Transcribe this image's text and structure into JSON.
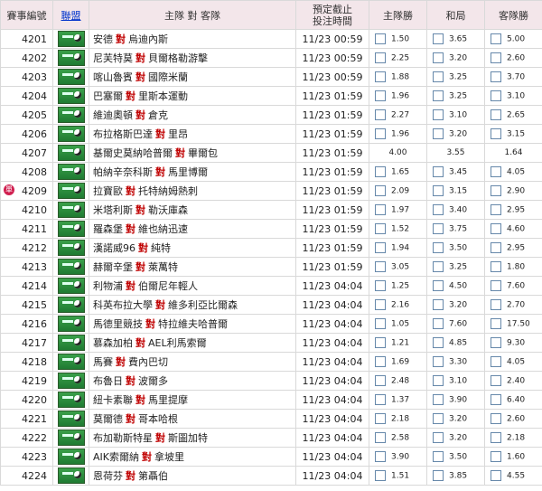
{
  "header": {
    "match_no": "賽事編號",
    "league": "聯盟",
    "teams": "主隊 對 客隊",
    "time": "預定截止\n投注時間",
    "home_win": "主隊勝",
    "draw": "和局",
    "away_win": "客隊勝"
  },
  "vs_label": "對",
  "single_badge": "單",
  "rows": [
    {
      "no": "4201",
      "home": "安德",
      "away": "烏迪內斯",
      "time": "11/23 00:59",
      "h": "1.50",
      "d": "3.65",
      "a": "5.00",
      "box": true
    },
    {
      "no": "4202",
      "home": "尼芙特莫",
      "away": "貝爾格勒游擊",
      "time": "11/23 00:59",
      "h": "2.25",
      "d": "3.20",
      "a": "2.60",
      "box": true
    },
    {
      "no": "4203",
      "home": "喀山魯賓",
      "away": "國際米蘭",
      "time": "11/23 00:59",
      "h": "1.88",
      "d": "3.25",
      "a": "3.70",
      "box": true
    },
    {
      "no": "4204",
      "home": "巴塞爾",
      "away": "里斯本運動",
      "time": "11/23 01:59",
      "h": "1.96",
      "d": "3.25",
      "a": "3.10",
      "box": true
    },
    {
      "no": "4205",
      "home": "維迪奧頓",
      "away": "倉克",
      "time": "11/23 01:59",
      "h": "2.27",
      "d": "3.10",
      "a": "2.65",
      "box": true
    },
    {
      "no": "4206",
      "home": "布拉格斯巴達",
      "away": "里昂",
      "time": "11/23 01:59",
      "h": "1.96",
      "d": "3.20",
      "a": "3.15",
      "box": true
    },
    {
      "no": "4207",
      "home": "基爾史莫納哈普爾",
      "away": "畢爾包",
      "time": "11/23 01:59",
      "h": "4.00",
      "d": "3.55",
      "a": "1.64",
      "box": false
    },
    {
      "no": "4208",
      "home": "帕納辛奈科斯",
      "away": "馬里博爾",
      "time": "11/23 01:59",
      "h": "1.65",
      "d": "3.45",
      "a": "4.05",
      "box": true
    },
    {
      "no": "4209",
      "home": "拉寶歐",
      "away": "托特納姆熱刺",
      "time": "11/23 01:59",
      "h": "2.09",
      "d": "3.15",
      "a": "2.90",
      "box": true,
      "single": true
    },
    {
      "no": "4210",
      "home": "米塔利斯",
      "away": "勒沃庫森",
      "time": "11/23 01:59",
      "h": "1.97",
      "d": "3.40",
      "a": "2.95",
      "box": true
    },
    {
      "no": "4211",
      "home": "羅森堡",
      "away": "維也納迅速",
      "time": "11/23 01:59",
      "h": "1.52",
      "d": "3.75",
      "a": "4.60",
      "box": true
    },
    {
      "no": "4212",
      "home": "漢諾威96",
      "away": "純特",
      "time": "11/23 01:59",
      "h": "1.94",
      "d": "3.50",
      "a": "2.95",
      "box": true
    },
    {
      "no": "4213",
      "home": "赫爾辛堡",
      "away": "萊萬特",
      "time": "11/23 01:59",
      "h": "3.05",
      "d": "3.25",
      "a": "1.80",
      "box": true
    },
    {
      "no": "4214",
      "home": "利物浦",
      "away": "伯爾尼年輕人",
      "time": "11/23 04:04",
      "h": "1.25",
      "d": "4.50",
      "a": "7.60",
      "box": true
    },
    {
      "no": "4215",
      "home": "科英布拉大學",
      "away": "維多利亞比爾森",
      "time": "11/23 04:04",
      "h": "2.16",
      "d": "3.20",
      "a": "2.70",
      "box": true
    },
    {
      "no": "4216",
      "home": "馬德里競技",
      "away": "特拉維夫哈普爾",
      "time": "11/23 04:04",
      "h": "1.05",
      "d": "7.60",
      "a": "17.50",
      "box": true
    },
    {
      "no": "4217",
      "home": "慕森加柏",
      "away": "AEL利馬索爾",
      "time": "11/23 04:04",
      "h": "1.21",
      "d": "4.85",
      "a": "9.30",
      "box": true
    },
    {
      "no": "4218",
      "home": "馬賽",
      "away": "費內巴切",
      "time": "11/23 04:04",
      "h": "1.69",
      "d": "3.30",
      "a": "4.05",
      "box": true
    },
    {
      "no": "4219",
      "home": "布魯日",
      "away": "波爾多",
      "time": "11/23 04:04",
      "h": "2.48",
      "d": "3.10",
      "a": "2.40",
      "box": true
    },
    {
      "no": "4220",
      "home": "紐卡素聯",
      "away": "馬里提摩",
      "time": "11/23 04:04",
      "h": "1.37",
      "d": "3.90",
      "a": "6.40",
      "box": true
    },
    {
      "no": "4221",
      "home": "莫爾德",
      "away": "哥本哈根",
      "time": "11/23 04:04",
      "h": "2.18",
      "d": "3.20",
      "a": "2.60",
      "box": true
    },
    {
      "no": "4222",
      "home": "布加勒斯特星",
      "away": "斯圖加特",
      "time": "11/23 04:04",
      "h": "2.58",
      "d": "3.20",
      "a": "2.18",
      "box": true
    },
    {
      "no": "4223",
      "home": "AIK索爾納",
      "away": "拿坡里",
      "time": "11/23 04:04",
      "h": "3.90",
      "d": "3.50",
      "a": "1.60",
      "box": true
    },
    {
      "no": "4224",
      "home": "恩荷芬",
      "away": "第聶伯",
      "time": "11/23 04:04",
      "h": "1.51",
      "d": "3.85",
      "a": "4.55",
      "box": true
    }
  ]
}
